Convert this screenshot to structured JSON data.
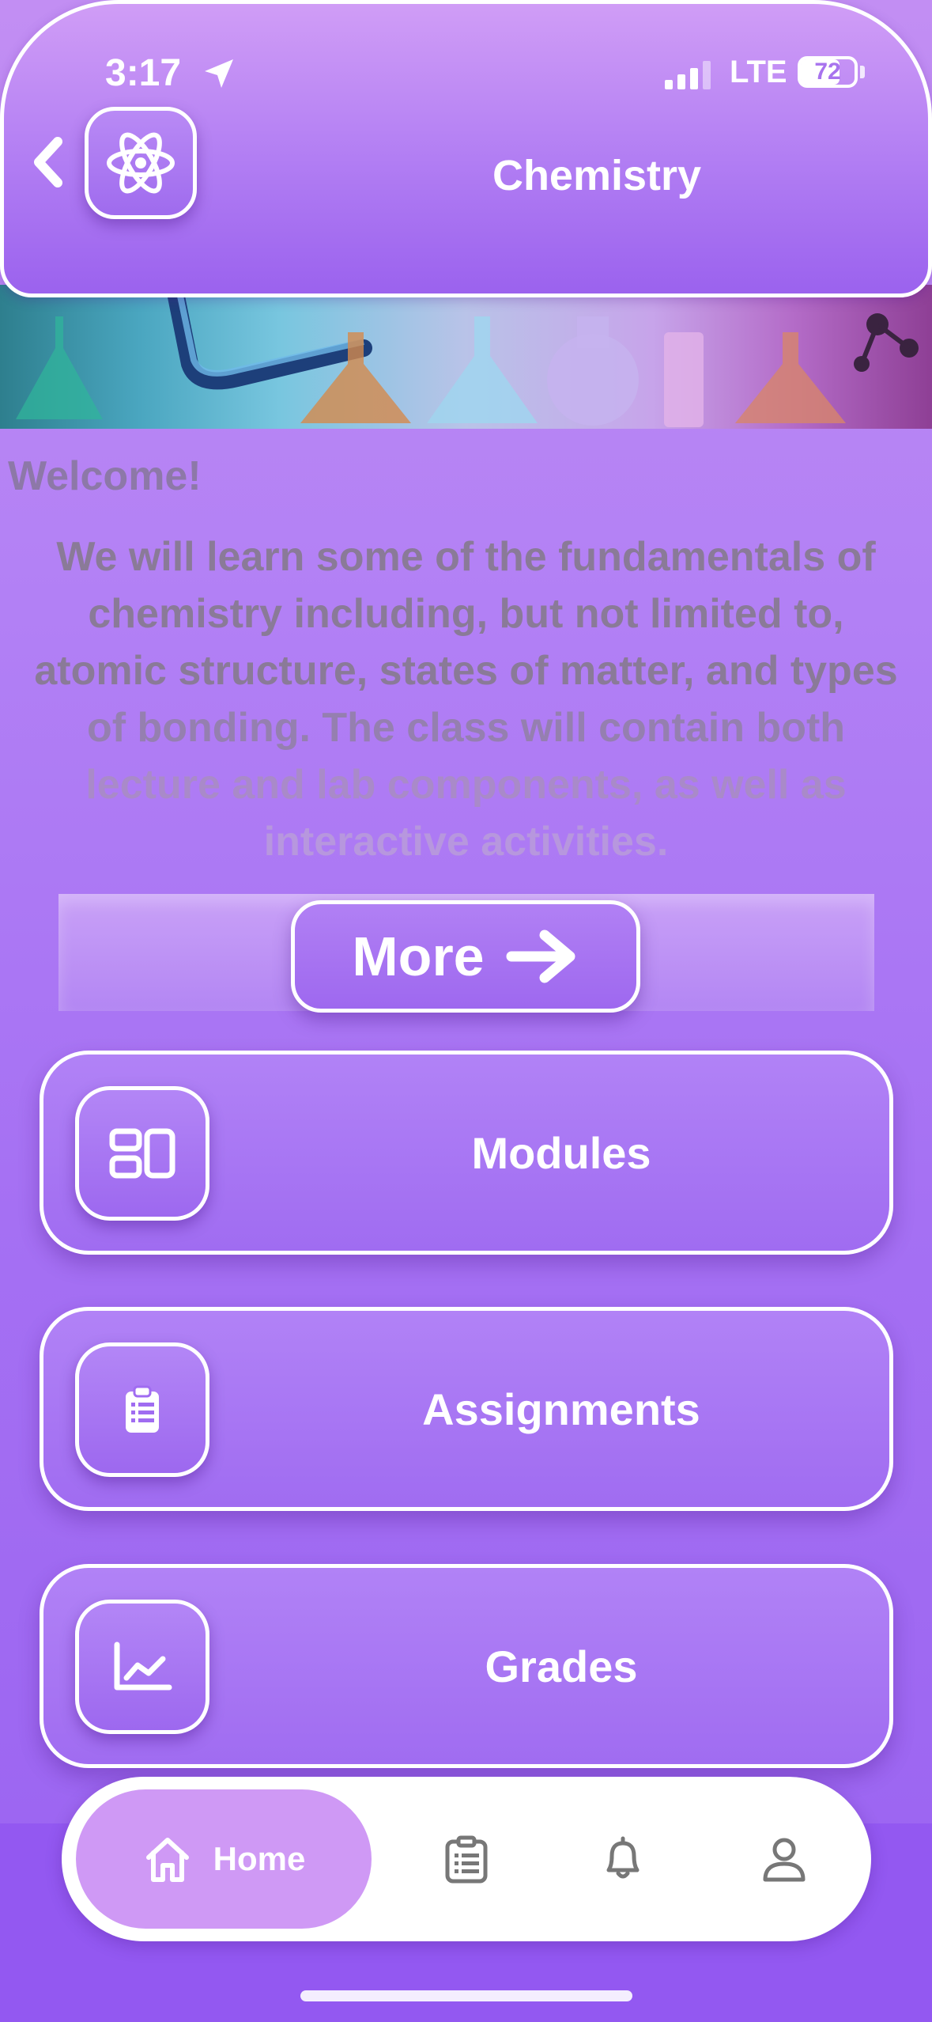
{
  "status_bar": {
    "time": "3:17",
    "network": "LTE",
    "battery": "72",
    "battery_level": 0.72
  },
  "header": {
    "title": "Chemistry",
    "icons": [
      "back-chevron-icon",
      "atom-icon"
    ]
  },
  "welcome": {
    "title": "Welcome!",
    "lines": [
      "We will learn some of the fundamentals of",
      "chemistry including, but not limited to,",
      "atomic structure, states of matter, and types",
      "of bonding. The class will contain both",
      "lecture and lab components, as well as",
      "interactive activities."
    ]
  },
  "more_button": {
    "label": "More",
    "icon": "arrow-right-icon"
  },
  "menu": [
    {
      "label": "Modules",
      "icon": "modules-icon"
    },
    {
      "label": "Assignments",
      "icon": "clipboard-icon"
    },
    {
      "label": "Grades",
      "icon": "line-chart-icon"
    }
  ],
  "tabbar": {
    "home_label": "Home",
    "tabs": [
      "home-icon",
      "clipboard-list-icon",
      "bell-icon",
      "user-icon"
    ],
    "active_color": "#cf99f5"
  },
  "colors": {
    "accent": "#a06cf1",
    "header": "#b17df3",
    "text_muted": "#8a7a98"
  }
}
